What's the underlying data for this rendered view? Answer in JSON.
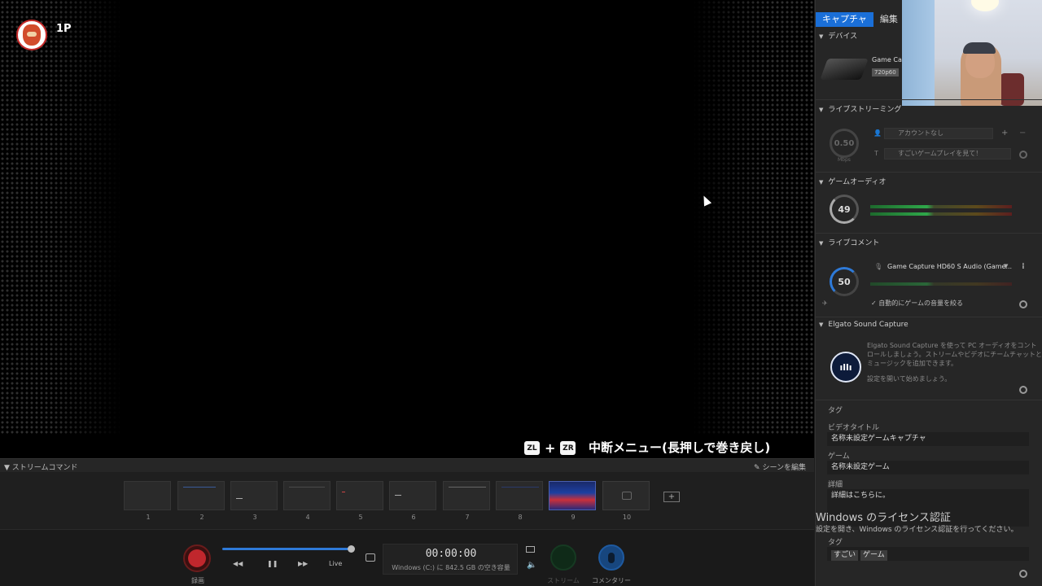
{
  "preview": {
    "player_label": "1P",
    "pause_keys": [
      "ZL",
      "ZR"
    ],
    "pause_plus": "+",
    "pause_text": "中断メニュー(長押しで巻き戻し)"
  },
  "stream": {
    "title": "ストリームコマンド",
    "edit_scenes": "シーンを編集",
    "scenes": [
      "1",
      "2",
      "3",
      "4",
      "5",
      "6",
      "7",
      "8",
      "9",
      "10"
    ],
    "active_scene": "9",
    "add_scene": "+"
  },
  "controls": {
    "record_label": "録画",
    "rewind": "◀◀",
    "pause": "❚❚",
    "forward": "▶▶",
    "live": "Live",
    "time": "00:00:00",
    "disk": "Windows (C:) に 842.5 GB の空き容量",
    "stream_label": "ストリーム",
    "commentary_label": "コメンタリー",
    "volume_icon": "🔈"
  },
  "panel": {
    "tabs": [
      "キャプチャ",
      "編集"
    ],
    "device": {
      "header": "デバイス",
      "name": "Game Capt",
      "resolution": "720p60"
    },
    "live": {
      "header": "ライブストリーミング",
      "bitrate": "0.50",
      "unit": "Mbps",
      "account": "アカウントなし",
      "title_placeholder": "すごいゲームプレイを見て！",
      "plus": "+",
      "minus": "−",
      "title_icon": "T"
    },
    "game_audio": {
      "header": "ゲームオーディオ",
      "level": "49"
    },
    "live_comment": {
      "header": "ライブコメント",
      "level": "50",
      "device": "Game Capture HD60 S Audio (Game...",
      "auto_lower": "✓ 自動的にゲームの音量を絞る"
    },
    "sound_capture": {
      "header": "Elgato Sound Capture",
      "desc1": "Elgato Sound Capture を使って PC オーディオをコント",
      "desc2": "ロールしましょう。ストリームやビデオにチームチャットと",
      "desc3": "ミュージックを追加できます。",
      "desc4": "設定を開いて始めましょう。"
    },
    "meta": {
      "tag_header": "タグ",
      "video_title_label": "ビデオタイトル",
      "video_title": "名称未設定ゲームキャプチャ",
      "game_label": "ゲーム",
      "game": "名称未設定ゲーム",
      "detail_label": "詳細",
      "detail": "詳細はこちらに。",
      "tags_label": "タグ",
      "tags": [
        "すごい",
        "ゲーム"
      ]
    },
    "windows_activation": {
      "line1": "Windows のライセンス認証",
      "line2": "設定を開き、Windows のライセンス認証を行ってください。"
    }
  }
}
